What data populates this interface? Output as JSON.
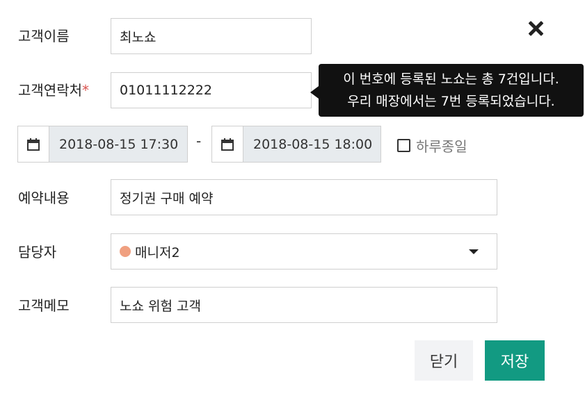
{
  "form": {
    "name_label": "고객이름",
    "name_value": "최노쇼",
    "phone_label": "고객연락처",
    "phone_required_mark": "*",
    "phone_value": "01011112222",
    "tooltip_line1": "이 번호에 등록된 노쇼는 총 7건입니다.",
    "tooltip_line2": "우리 매장에서는 7번 등록되었습니다.",
    "start_datetime": "2018-08-15 17:30",
    "date_separator": "-",
    "end_datetime": "2018-08-15 18:00",
    "all_day_label": "하루종일",
    "all_day_checked": false,
    "content_label": "예약내용",
    "content_value": "정기권 구매 예약",
    "staff_label": "담당자",
    "staff_value": "매니저2",
    "staff_color": "#f0a080",
    "memo_label": "고객메모",
    "memo_value": "노쇼 위험 고객"
  },
  "actions": {
    "close_label": "닫기",
    "save_label": "저장",
    "save_color": "#129a82"
  },
  "icons": {
    "close": "close-icon",
    "calendar": "calendar-icon",
    "dropdown": "chevron-down-icon"
  }
}
